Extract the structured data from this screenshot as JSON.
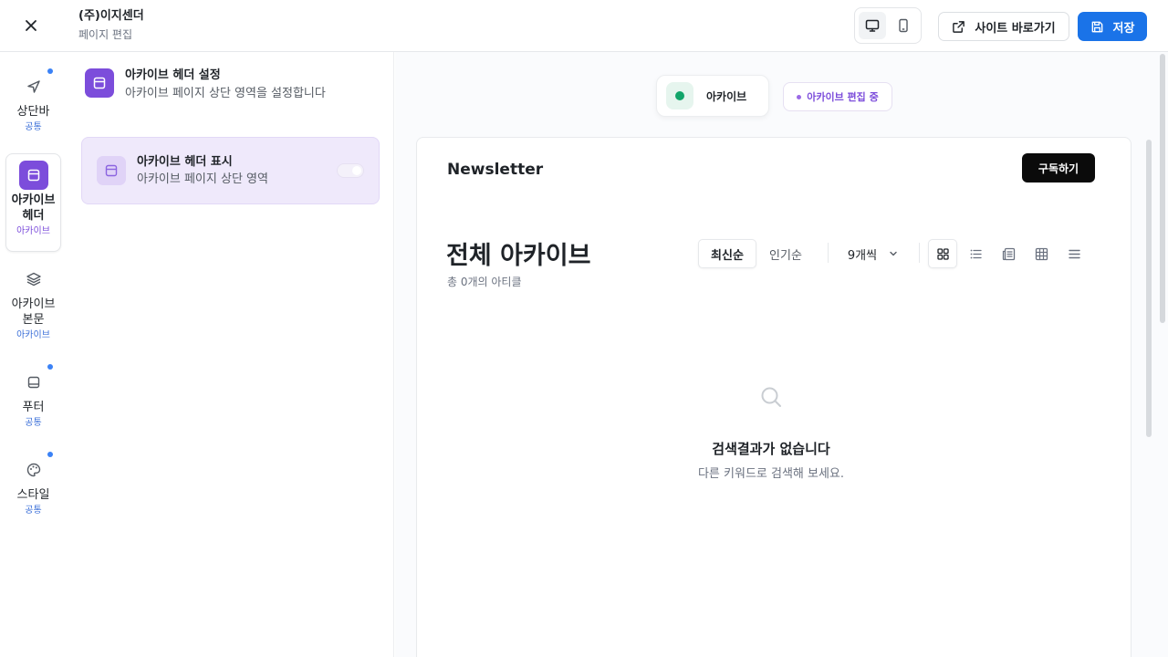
{
  "header": {
    "title": "(주)이지센더",
    "subtitle": "페이지 편집",
    "site_button": "사이트 바로가기",
    "save_button": "저장",
    "accent": "#1a73e8"
  },
  "rail": {
    "items": [
      {
        "label": "상단바",
        "sub": "공통",
        "icon": "send-icon"
      },
      {
        "label": "아카이브\n헤더",
        "sub": "아카이브",
        "icon": "layout-icon"
      },
      {
        "label": "아카이브\n본문",
        "sub": "아카이브",
        "icon": "layers-icon"
      },
      {
        "label": "푸터",
        "sub": "공통",
        "icon": "footer-icon"
      },
      {
        "label": "스타일",
        "sub": "공통",
        "icon": "palette-icon"
      }
    ]
  },
  "panel": {
    "title": "아카이브 헤더 설정",
    "desc": "아카이브 페이지 상단 영역을 설정합니다",
    "card_title": "아카이브 헤더 표시",
    "card_desc": "아카이브 페이지 상단 영역",
    "toggle_on": true,
    "accent": "#7c4ddb"
  },
  "preview": {
    "page_tab": "아카이브",
    "edit_badge": "아카이브 편집 중",
    "brand": "Newsletter",
    "subscribe": "구독하기",
    "archive_title": "전체 아카이브",
    "archive_count": "총 0개의 아티클",
    "sort_latest": "최신순",
    "sort_popular": "인기순",
    "per_page": "9개씩",
    "empty_title": "검색결과가 없습니다",
    "empty_desc": "다른 키워드로 검색해 보세요."
  }
}
